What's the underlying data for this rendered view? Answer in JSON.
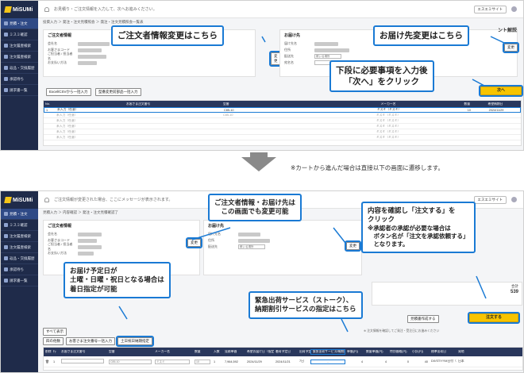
{
  "brand": {
    "name": "MiSUMi"
  },
  "shot1": {
    "topbar_message": "お見積り・ご注文情報を入力して、次へお進みください。",
    "site_button": "エスエミサイト",
    "breadcrumb": "投資入力 ＞ 発注・注文見積照会 ＞ 発注・注文見積照会一覧表",
    "help_link": "ント解説",
    "sidebar": [
      "見積・注文",
      "ミスミ確認",
      "注文履歴検索",
      "注文履歴検索",
      "返品・交換履歴",
      "承認待ち",
      "請求書一覧"
    ],
    "orderer_panel_title": "ご注文者情報",
    "orderer_fields": [
      "会社名",
      "お客さまコード",
      "ご担当者 / 担当者名",
      "お支払い方法"
    ],
    "change_label": "変更",
    "delivery_panel_title": "お届け先",
    "delivery_fields": [
      "届け先名",
      "住所",
      "配送先",
      "宛名名"
    ],
    "delivery_select": "帳いる場所",
    "excel_button": "Excel/CSVから一括入力",
    "bulk_button": "型番変更前部品一括入力",
    "next_button": "次へ",
    "table_headers": [
      "No.",
      "お客さま注文番号",
      "型番",
      "メーカー名",
      "数量",
      "希望納期日"
    ],
    "row_sample": [
      "1",
      "未入力（任意）",
      "C85-10",
      "ミスミ（ミスミ）",
      "10",
      "2024/11/29"
    ],
    "row_placeholder": [
      "未入力（任意）",
      "C85-10",
      "ミスミ（ミスミ）"
    ]
  },
  "callouts1": {
    "orderer_change": "ご注文者情報変更はこちら",
    "delivery_change": "お届け先変更はこちら",
    "next_step": "下段に必要事項を入力後\n「次へ」をクリック"
  },
  "between_note": "※カートから進んだ場合は直接以下の画面に遷移します。",
  "shot2": {
    "topbar_message": "ご注文情報が変更された場合、ここにメッセージが表示されます。",
    "site_button": "エスエミサイト",
    "breadcrumb": "見積入力 ＞ 内容確認 ＞ 発注・注文見積確認了",
    "orderer_panel_title": "ご注文者情報",
    "delivery_panel_title": "お届け先",
    "change_label": "変更",
    "total_label": "合計",
    "total_value": "539",
    "quote_button": "見積書作成する",
    "order_button": "注文する",
    "tabs": [
      "すべて表示",
      "お客さま注文番号一括入力",
      "土日祝日納期指定"
    ],
    "tab_prefix": "四の他数",
    "footnote": "※ 注文情報を確認してご発注・受注日にお進みください",
    "table_headers": [
      "削除",
      "行",
      "お客さま注文番号",
      "型番",
      "メーカー名",
      "数量",
      "入数",
      "見積単価",
      "希望お届け日（指定）",
      "着荷予定日",
      "出荷予定",
      "緊急出荷サービス/納期割引サービス",
      "単価(円)",
      "数量単価(円)",
      "特別価格(円)",
      "小計(円)",
      "標準出荷日",
      "発地"
    ],
    "row": [
      "1",
      "C85-10",
      "ミスミ",
      "10",
      "1",
      "7,964,592",
      "2024/11/29",
      "2024/11/21",
      "7日",
      "-",
      "4",
      "4",
      "0",
      "40",
      "DX/ST/YYM日付（日）",
      "日本"
    ]
  },
  "callouts2": {
    "editable": "ご注文者情報・お届け先は\nこの画面でも変更可能",
    "confirm": "内容を確認し「注文する」を\nクリック",
    "confirm_note": "※承認者の承認が必要な場合は\n　ボタン名が「注文を承認依頼する」\n　となります。",
    "weekend": "お届け予定日が\n土曜・日曜・祝日となる場合は\n着日指定が可能",
    "express": "緊急出荷サービス（ストーク）、\n納期割引サービスの指定はこちら"
  },
  "colors": {
    "accent": "#1a7ad4",
    "sidebar": "#1f2b4a",
    "cta": "#f7c400"
  }
}
